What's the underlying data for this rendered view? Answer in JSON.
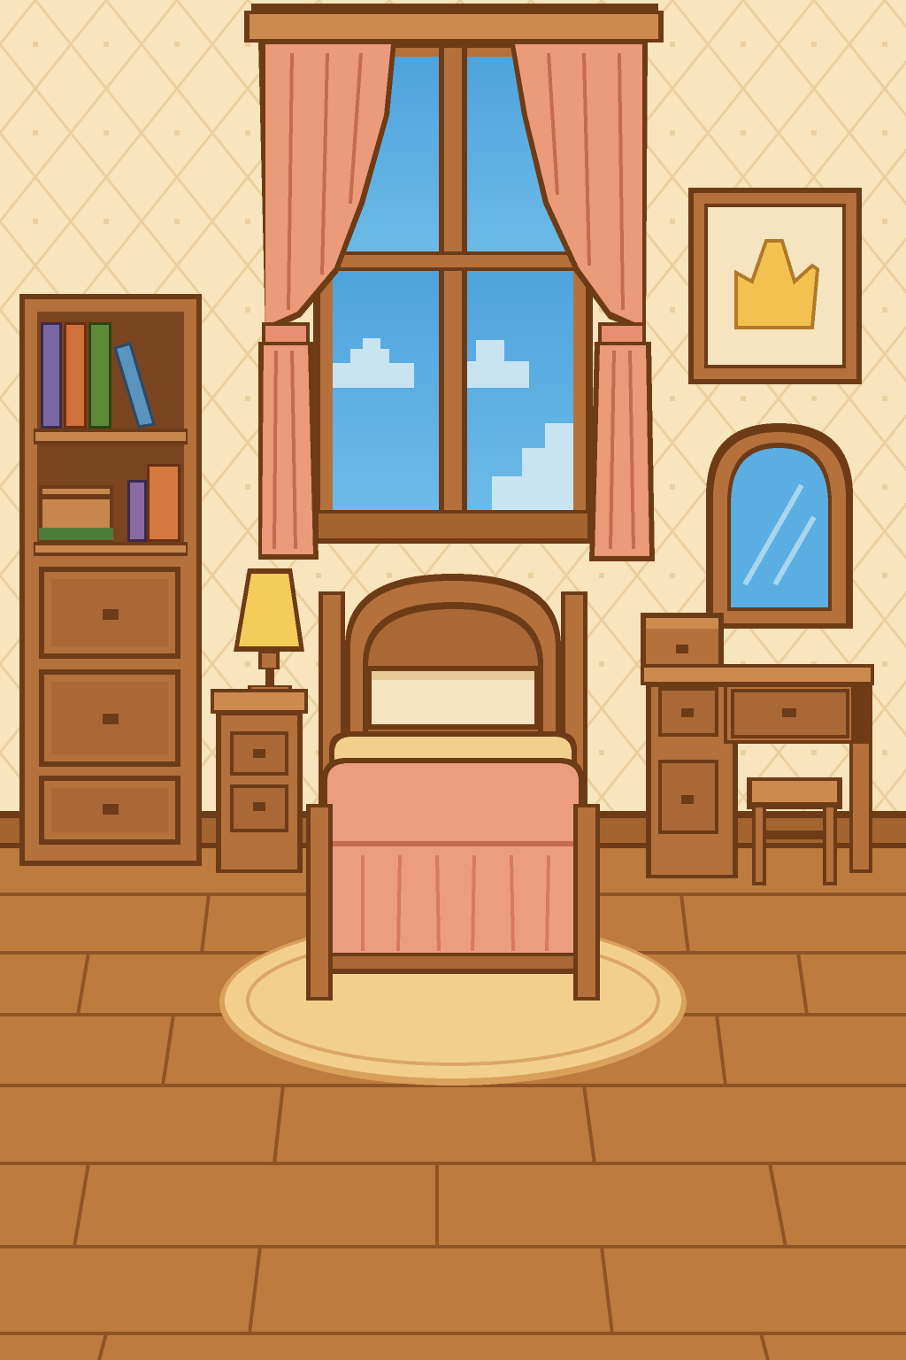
{
  "scene": {
    "style": "pixel-art",
    "room": "bedroom",
    "objects": [
      "window-with-curtains",
      "bookshelf-with-drawers",
      "framed-picture",
      "table-lamp",
      "nightstand",
      "single-bed",
      "vanity-mirror",
      "vanity-desk",
      "stool",
      "round-rug"
    ],
    "bookshelf": {
      "top_shelf_books": 4,
      "bottom_shelf_books": 2,
      "boxes": 1,
      "drawers": 3
    },
    "nightstand_drawers": 2,
    "vanity_drawers": 4,
    "sky_clouds": 3,
    "picture_motif": "yellow-leaf",
    "palette": {
      "wallpaper": "#f8e5bd",
      "wallpaper_pattern": "#eccf9c",
      "wood": "#b5713c",
      "wood_dark": "#6e3b17",
      "wood_light": "#cc8a4f",
      "floor": "#bd7a40",
      "curtain": "#eb9a7a",
      "sky": "#5aaee2",
      "blanket": "#eb9d7f",
      "rug": "#f3cf8e",
      "lamp_shade": "#f5cc5a"
    }
  }
}
